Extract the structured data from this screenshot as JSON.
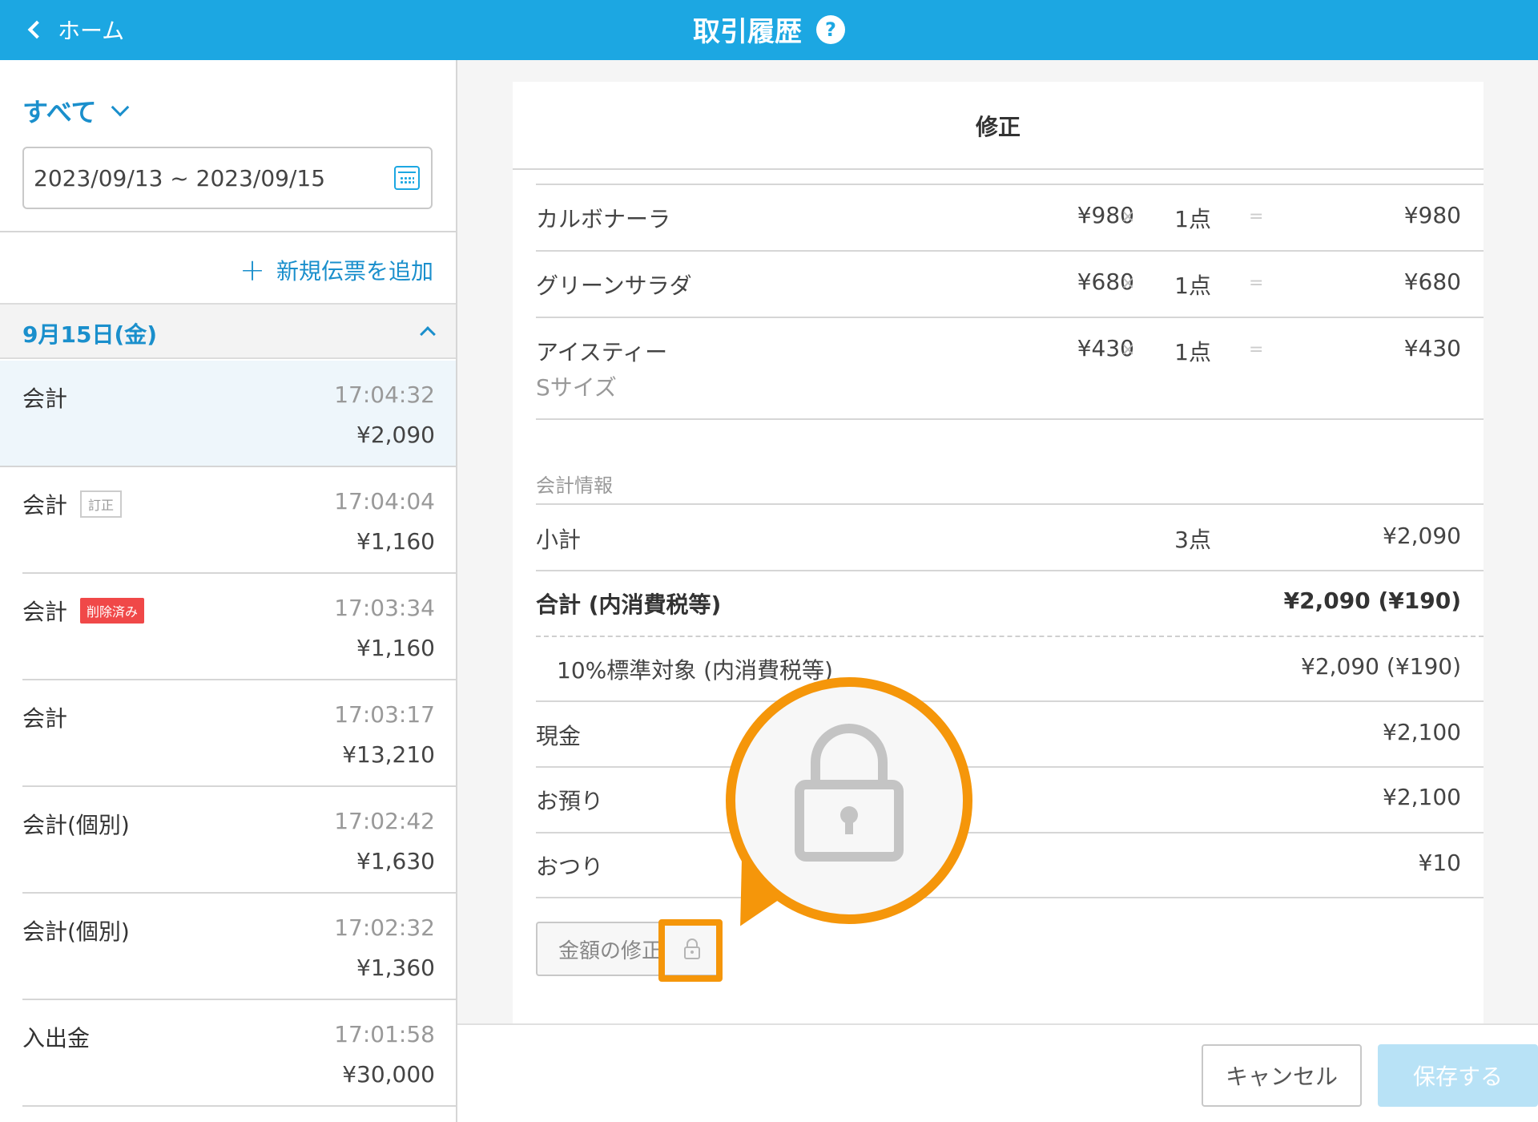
{
  "header": {
    "back_label": "ホーム",
    "title": "取引履歴",
    "help_glyph": "?"
  },
  "sidebar": {
    "filter_label": "すべて",
    "date_range": "2023/09/13 ~ 2023/09/15",
    "add_slip_label": "新規伝票を追加",
    "date_group": "9月15日(金)",
    "transactions": [
      {
        "kind": "会計",
        "badge": "",
        "time": "17:04:32",
        "amount": "¥2,090"
      },
      {
        "kind": "会計",
        "badge": "訂正",
        "time": "17:04:04",
        "amount": "¥1,160"
      },
      {
        "kind": "会計",
        "badge": "削除済み",
        "time": "17:03:34",
        "amount": "¥1,160"
      },
      {
        "kind": "会計",
        "badge": "",
        "time": "17:03:17",
        "amount": "¥13,210"
      },
      {
        "kind": "会計(個別)",
        "badge": "",
        "time": "17:02:42",
        "amount": "¥1,630"
      },
      {
        "kind": "会計(個別)",
        "badge": "",
        "time": "17:02:32",
        "amount": "¥1,360"
      },
      {
        "kind": "入出金",
        "badge": "",
        "time": "17:01:58",
        "amount": "¥30,000"
      }
    ]
  },
  "detail": {
    "title": "修正",
    "items": [
      {
        "name": "カルボナーラ",
        "unit_price": "¥980",
        "times": "×",
        "qty": "1点",
        "equals": "=",
        "total": "¥980"
      },
      {
        "name": "グリーンサラダ",
        "unit_price": "¥680",
        "times": "×",
        "qty": "1点",
        "equals": "=",
        "total": "¥680"
      },
      {
        "name": "アイスティー",
        "option": "Sサイズ",
        "unit_price": "¥430",
        "times": "×",
        "qty": "1点",
        "equals": "=",
        "total": "¥430"
      }
    ],
    "payment_section_label": "会計情報",
    "subtotal": {
      "label": "小計",
      "qty": "3点",
      "amount": "¥2,090"
    },
    "total": {
      "label": "合計 (内消費税等)",
      "amount": "¥2,090 (¥190)"
    },
    "tax": {
      "label": "10%標準対象 (内消費税等)",
      "amount": "¥2,090 (¥190)"
    },
    "cash": {
      "label": "現金",
      "amount": "¥2,100"
    },
    "deposit": {
      "label": "お預り",
      "amount": "¥2,100"
    },
    "change": {
      "label": "おつり",
      "amount": "¥10"
    },
    "edit_amount_label": "金額の修正"
  },
  "footer": {
    "cancel_label": "キャンセル",
    "save_label": "保存する"
  },
  "colors": {
    "header_bg": "#1ca7e2",
    "accent": "#1a8fcc",
    "callout": "#f5960a",
    "delete_badge": "#f04848"
  },
  "icons": [
    "chevron-left-icon",
    "help-icon",
    "chevron-down-icon",
    "calendar-icon",
    "plus-icon",
    "chevron-up-icon",
    "lock-icon"
  ]
}
